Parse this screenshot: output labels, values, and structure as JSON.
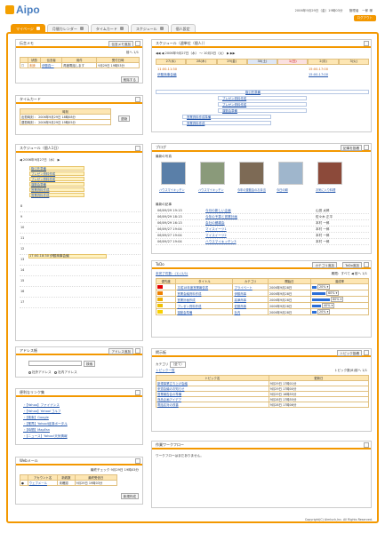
{
  "app": {
    "logo": "Aipo"
  },
  "header": {
    "info": "2006年9月29日（金）19時03分　　管理者　一郎 様",
    "button": "ログアウト"
  },
  "tabs": [
    {
      "label": "マイページ",
      "active": true
    },
    {
      "label": "月間カレンダー"
    },
    {
      "label": "タイムカード"
    },
    {
      "label": "スケジュール"
    },
    {
      "label": "個人設定"
    }
  ],
  "memo": {
    "title": "伝言メモ",
    "add": "伝言メモ追加",
    "nav": "前へ 1/1",
    "headers": [
      "状態",
      "伝言者",
      "用件",
      "受付日時"
    ],
    "row": [
      "未読",
      "伊藤真一",
      "再度電話します",
      "9月29日 19時53分"
    ],
    "delete": "削除する"
  },
  "timecard": {
    "title": "タイムカード",
    "header": "時刻",
    "btn": "退勤",
    "rows": [
      "出勤時刻 ： 2006年9月29日 18時08分",
      "退勤時刻 ： 2006年9月29日 19時05分"
    ]
  },
  "schedDay": {
    "title": "スケジュール（個人1日）",
    "date": "2006年9月27日（水）",
    "allday": [
      "取引先準備",
      "プレゼン資料作成",
      "プレゼン資料作成",
      "運動会準備",
      "営業資料作成",
      "営業資料作成"
    ],
    "hours": [
      "8",
      "9",
      "10",
      "11",
      "12",
      "13",
      "14",
      "15",
      "16",
      "17"
    ],
    "event": "17:00-18:30 伊藤商事会議"
  },
  "address": {
    "title": "アドレス帳",
    "add": "アドレス追加",
    "search": "検索",
    "radios": [
      "社外アドレス",
      "社内アドレス"
    ]
  },
  "links": {
    "title": "便利なリンク集",
    "items": [
      "【Yahoo】ファイナンス",
      "【Yahoo】Yahoo!ゴルフ",
      "【検索】Google",
      "【業界】Yahoo!経済ポータル",
      "【時間】MapFan",
      "【ニュース】Yahoo!天気情報"
    ]
  },
  "webmail": {
    "title": "Webメール",
    "info": "最終チェック 9月29日 19時03分",
    "headers": [
      "アカウント名",
      "新着数",
      "最終受信日"
    ],
    "row": [
      "ウェブメール",
      "未確認",
      "9月29日 19時03分"
    ],
    "btn": "新規作成"
  },
  "schedWeek": {
    "title": "スケジュール（週単位（個人））",
    "range": "2006年9月27日（水） 〜 10月3日（火）",
    "days": [
      "27(水)",
      "28(木)",
      "29(金)",
      "30(土)",
      "1(日)",
      "2(月)",
      "3(火)"
    ],
    "e1": "11:00-11:30",
    "e1b": "伊藤商事会議",
    "e2": "15:00-17:00",
    "e2b": "15:00-17:00",
    "spans": [
      "取引先準備",
      "プレゼン資料作成",
      "プレゼン資料作成",
      "運動会準備",
      "営業資料作成準備",
      "営業資料作成"
    ]
  },
  "blog": {
    "title": "ブログ",
    "add": "記事を投稿",
    "recentLabel": "最新の写真",
    "photos": [
      "ハウスマイキッチン",
      "ハウスマイキッチン",
      "今年の運動会のお弁当",
      "今日の朝",
      "お気に入り料理"
    ],
    "recentEntries": "最新の記事",
    "entries": [
      [
        "06/09/29 19:13",
        "今月の新しい企画",
        "山田 太郎"
      ],
      [
        "06/09/29 18:13",
        "今年の予算と営業計画",
        "佐々木 正平"
      ],
      [
        "06/09/29 16:13",
        "会社の懇親会",
        "本村 一郎"
      ],
      [
        "06/09/27 19:04",
        "マイスイーツ1",
        "本村 一郎"
      ],
      [
        "06/09/27 19:04",
        "マイスイーツ2",
        "本村 一郎"
      ],
      [
        "06/09/27 19:04",
        "ハウスマイキッチン3",
        "本村 一郎"
      ]
    ]
  },
  "todo": {
    "title": "ToDo",
    "add": "ToDo追加",
    "catadd": "カテゴリ追加",
    "filter": "未完了件数：(1) (1/1)",
    "nav": "期限：すべて ◀ 前へ 1/1",
    "headers": [
      "優先度",
      "タイトル",
      "カテゴリ",
      "開始日",
      "達成率"
    ],
    "rows": [
      {
        "title": "平成18年度営業報告書",
        "cat": "プライベート",
        "date": "2006年9月28日",
        "pct": "20%",
        "color": "#e60000"
      },
      {
        "title": "営業会議資料作成",
        "cat": "伊藤商事",
        "date": "2006年9月28日",
        "pct": "60%",
        "color": "#f08000"
      },
      {
        "title": "営業計画作成",
        "cat": "高津商事",
        "date": "2006年9月28日",
        "pct": "80%",
        "color": "#f0b000"
      },
      {
        "title": "プレゼン資料作成",
        "cat": "佐藤商事",
        "date": "2006年9月28日",
        "pct": "40%",
        "color": "#f0c000"
      },
      {
        "title": "運動会準備",
        "cat": "社内",
        "date": "2006年9月28日",
        "pct": "20%",
        "color": "#f8d000"
      }
    ]
  },
  "board": {
    "title": "掲示板",
    "add": "トピック投稿",
    "category": "カテゴリ",
    "catVal": "（全て）",
    "filter": "トピック一覧",
    "nav": "トピック数(8)前へ 1/1",
    "headers": [
      "トピック名",
      "更新日"
    ],
    "rows": [
      [
        "新規事業立ち上げ会議",
        "9月29日 17時01分"
      ],
      [
        "来週会議のお知らせ",
        "9月29日 17時00分"
      ],
      [
        "営業報告会の準備",
        "9月29日 16時55分"
      ],
      [
        "商品企画アイデア",
        "9月28日 17時55分"
      ],
      [
        "電話応対の改善",
        "9月28日 17時06分"
      ]
    ]
  },
  "workflow": {
    "title": "作業ワークフロー",
    "text": "ワークフローはまだありません。"
  },
  "footer": "Copyright(C) Aimluck,Inc. All Rights Reserved."
}
